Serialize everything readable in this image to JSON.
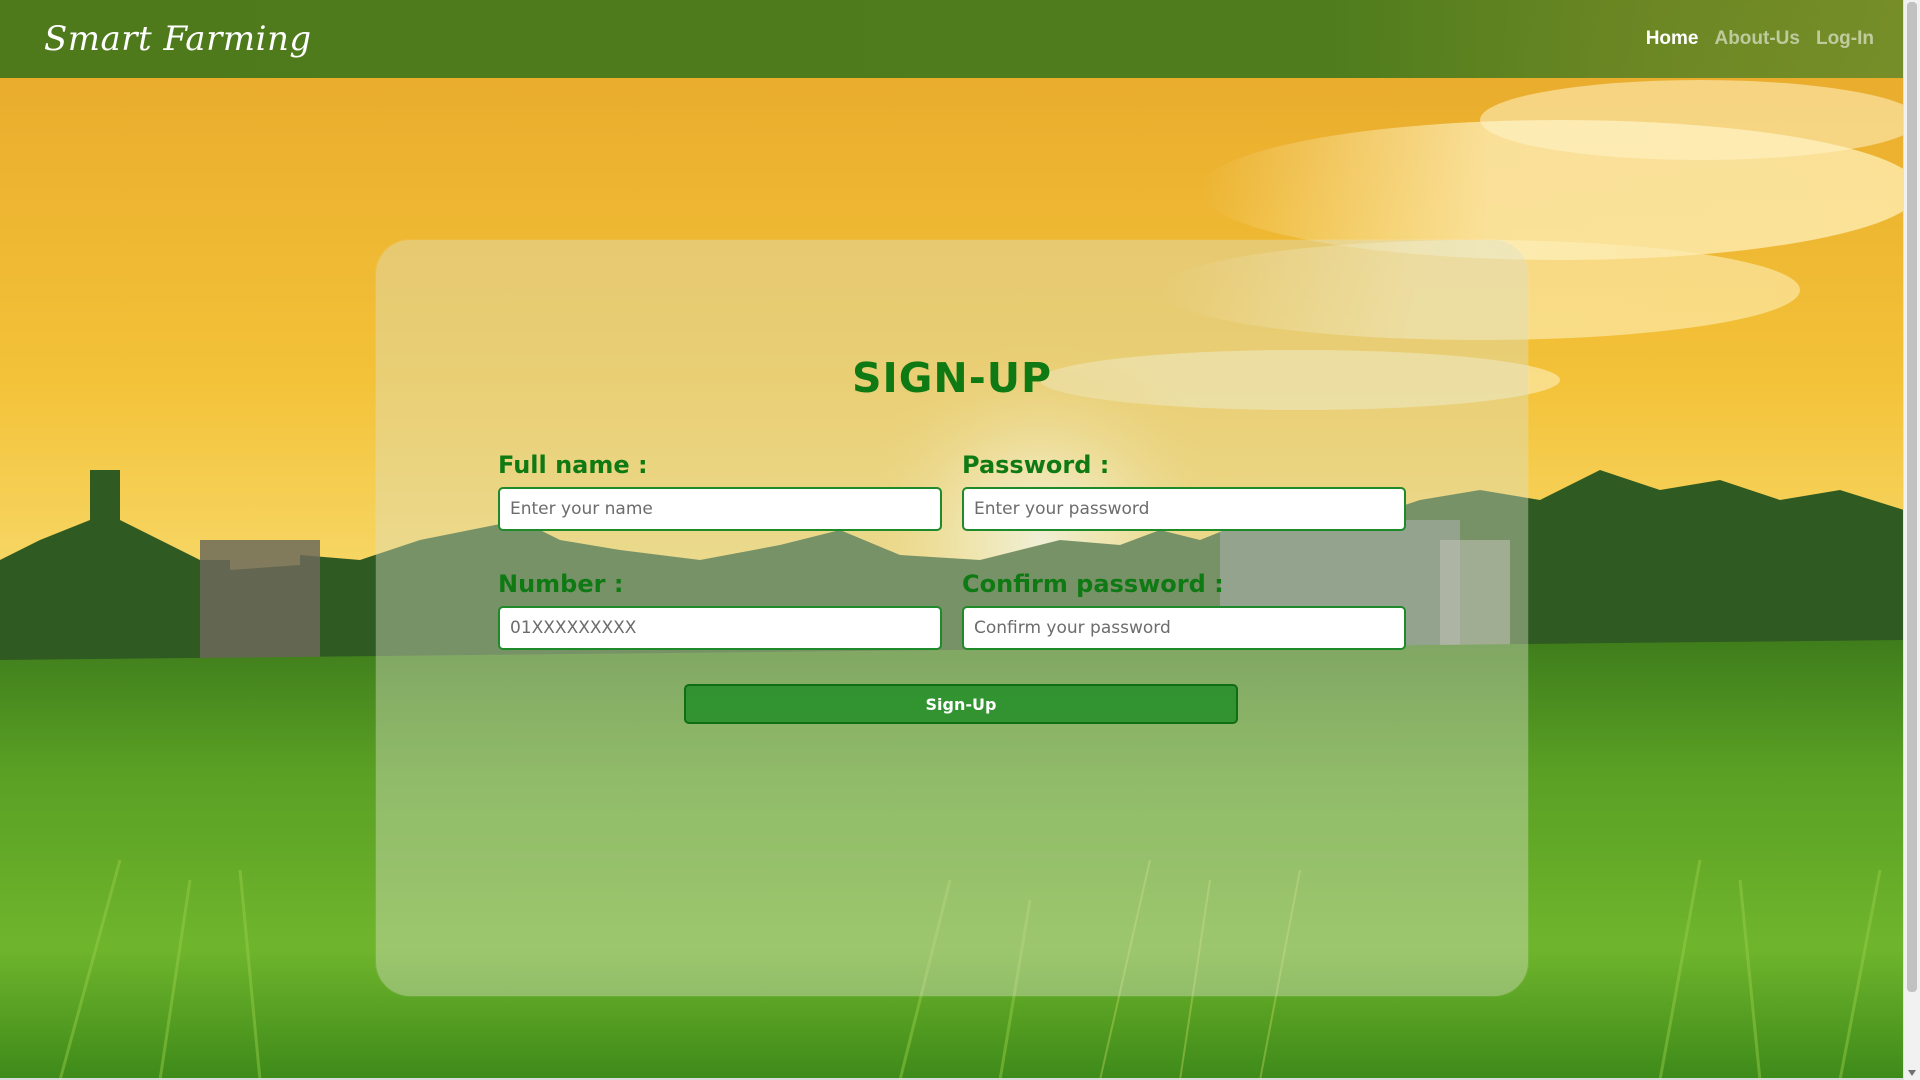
{
  "brand": {
    "name": "Smart Farming"
  },
  "nav": {
    "items": [
      {
        "label": "Home",
        "active": true
      },
      {
        "label": "About-Us",
        "active": false
      },
      {
        "label": "Log-In",
        "active": false
      }
    ]
  },
  "form": {
    "title": "SIGN-UP",
    "fields": {
      "full_name": {
        "label": "Full name :",
        "placeholder": "Enter your name",
        "value": ""
      },
      "password": {
        "label": "Password :",
        "placeholder": "Enter your password",
        "value": ""
      },
      "number": {
        "label": "Number :",
        "placeholder": "01XXXXXXXXX",
        "value": ""
      },
      "confirm_password": {
        "label": "Confirm password :",
        "placeholder": "Confirm your password",
        "value": ""
      }
    },
    "submit_label": "Sign-Up"
  },
  "colors": {
    "navbar": "#4e7a1c",
    "heading_green": "#0f7a14",
    "button_green": "#208c26",
    "input_border": "#1f8a2a"
  }
}
